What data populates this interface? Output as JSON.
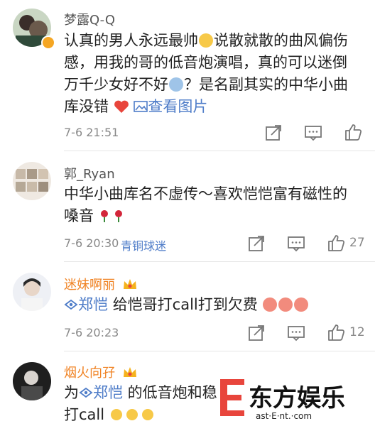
{
  "comments": [
    {
      "username": "梦露Q-Q",
      "text_lines": [
        "认真的男人永远最帅",
        "说散就散的曲风偏伤",
        "感，用我的哥的低音炮演唱，真的可以迷倒",
        "万千少女好不好",
        "？是名副其实的中华小曲",
        "库没错"
      ],
      "view_image": "查看图片",
      "time": "7-6 21:51"
    },
    {
      "username": "郭_Ryan",
      "text_lines": [
        "中华小曲库名不虚传～喜欢恺恺富有磁性的",
        "嗓音"
      ],
      "time": "7-6 20:30",
      "tag": "青铜球迷",
      "likes": "27"
    },
    {
      "username": "迷妹啊丽",
      "mention": "郑恺",
      "text": " 给恺哥打call打到欠费",
      "time": "7-6 20:23",
      "likes": "12"
    },
    {
      "username": "烟火向孖",
      "prefix": "为",
      "mention": "郑恺",
      "text_lines": [
        " 的低音炮和稳",
        "打call"
      ]
    }
  ],
  "watermark": {
    "brand": "东方娱乐",
    "domain": "ast·E·nt.·com",
    "letter": "E"
  },
  "colors": {
    "link": "#4e7cc8",
    "orange_name": "#f08324",
    "heart": "#e8453c"
  }
}
